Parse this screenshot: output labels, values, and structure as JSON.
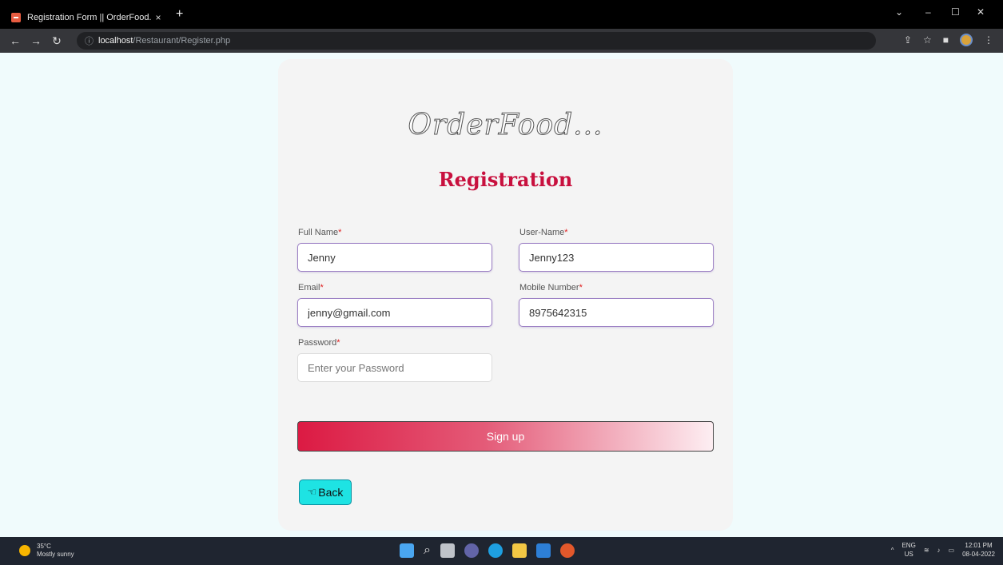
{
  "browser": {
    "tab_title": "Registration Form || OrderFood...",
    "tab_close": "×",
    "new_tab": "+",
    "url_host": "localhost",
    "url_path": "/Restaurant/Register.php"
  },
  "page": {
    "brand": "OrderFood...",
    "title": "Registration",
    "fields": {
      "full_name": {
        "label": "Full Name",
        "value": "Jenny"
      },
      "user_name": {
        "label": "User-Name",
        "value": "Jenny123"
      },
      "email": {
        "label": "Email",
        "value": "jenny@gmail.com"
      },
      "mobile": {
        "label": "Mobile Number",
        "value": "8975642315"
      },
      "password": {
        "label": "Password",
        "placeholder": "Enter your Password"
      }
    },
    "required_mark": "*",
    "signup_label": "Sign up",
    "back_label": "Back"
  },
  "taskbar": {
    "temperature": "35°C",
    "weather": "Mostly sunny",
    "lang_top": "ENG",
    "lang_bottom": "US",
    "time": "12:01 PM",
    "date": "08-04-2022"
  },
  "colors": {
    "title": "#c8103e",
    "signup_start": "#dc1a43",
    "back_bg": "#1ee3e3"
  }
}
